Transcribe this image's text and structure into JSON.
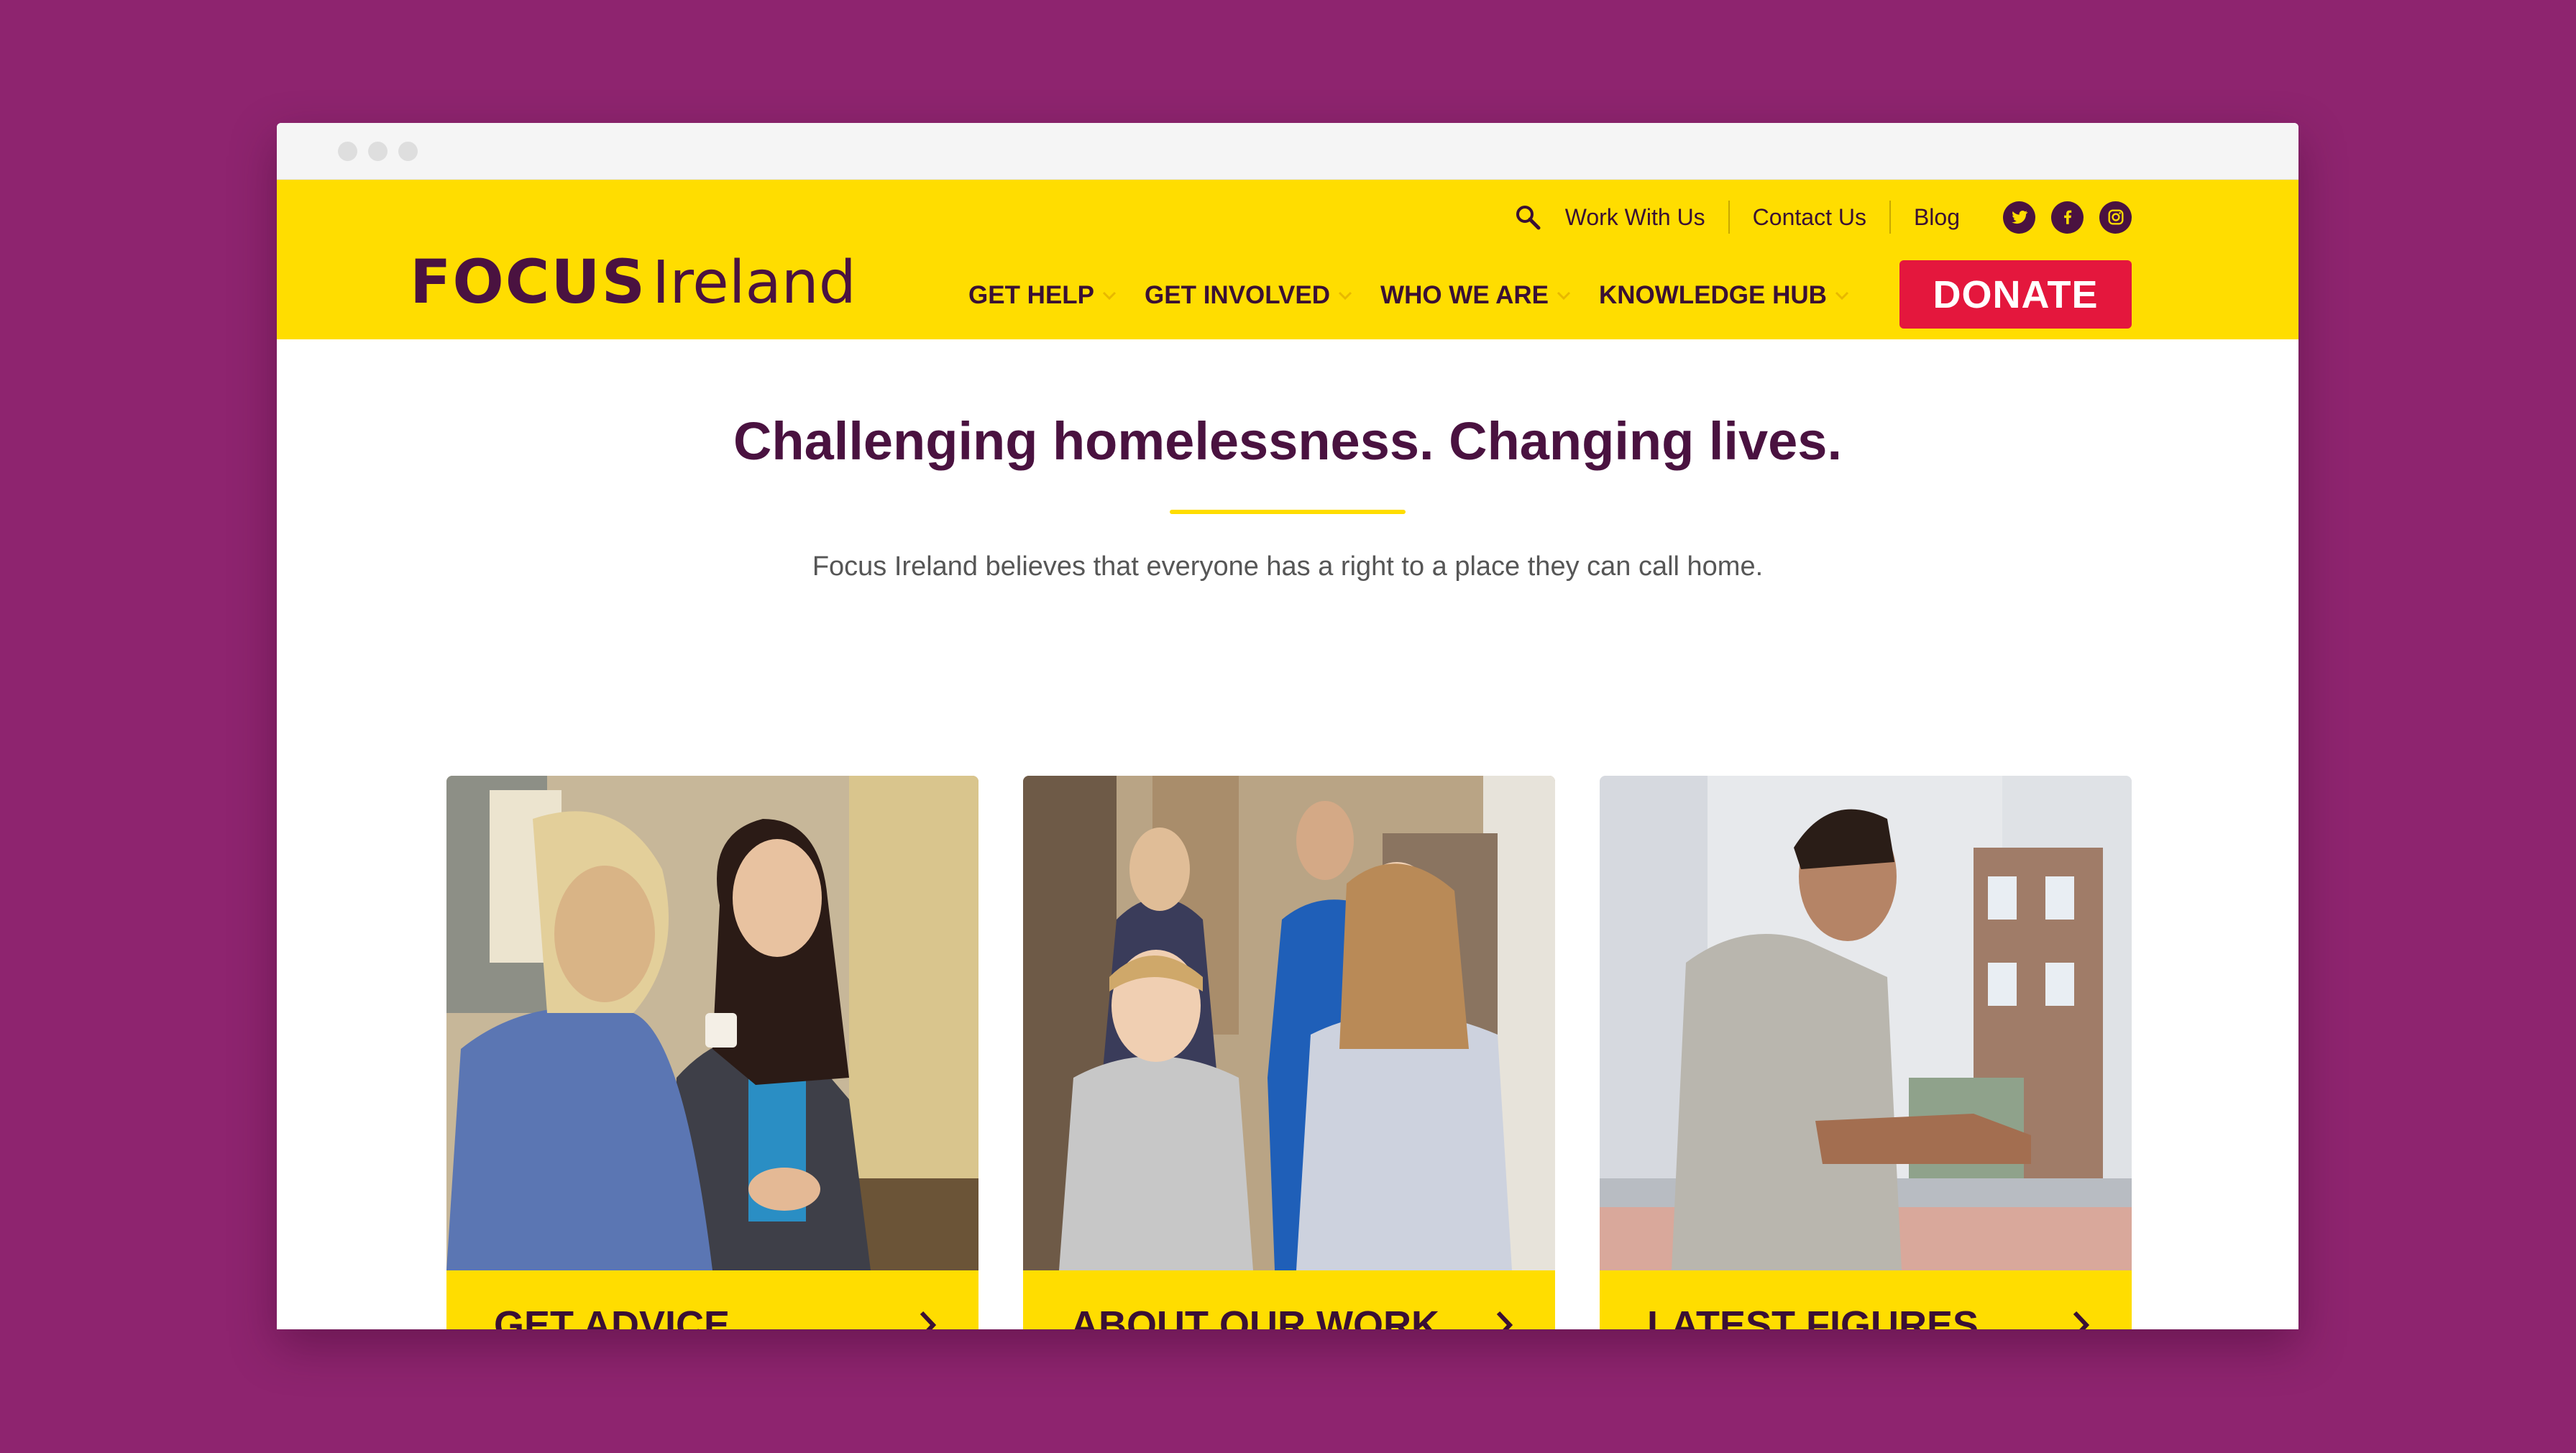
{
  "page": {
    "background_color": "#8e246f"
  },
  "browser": {
    "dots": 3
  },
  "header": {
    "background_color": "#ffdd00",
    "logo": {
      "focus": "FOCUS",
      "ireland": "Ireland"
    },
    "top_links": [
      {
        "label": "Work With Us"
      },
      {
        "label": "Contact Us"
      },
      {
        "label": "Blog"
      }
    ],
    "search_icon": "search-icon",
    "socials": [
      {
        "icon": "twitter-icon"
      },
      {
        "icon": "facebook-icon"
      },
      {
        "icon": "instagram-icon"
      }
    ],
    "nav": [
      {
        "label": "GET HELP"
      },
      {
        "label": "GET INVOLVED"
      },
      {
        "label": "WHO WE ARE"
      },
      {
        "label": "KNOWLEDGE HUB"
      }
    ],
    "donate_label": "DONATE",
    "donate_color": "#e4173d"
  },
  "main": {
    "headline": "Challenging homelessness. Changing lives.",
    "subtitle": "Focus Ireland believes that everyone has a right to a place they can call home.",
    "cards": [
      {
        "label": "GET ADVICE",
        "icon": "chevron-right-icon"
      },
      {
        "label": "ABOUT OUR WORK",
        "icon": "chevron-right-icon"
      },
      {
        "label": "LATEST FIGURES",
        "icon": "chevron-right-icon"
      }
    ]
  },
  "colors": {
    "brand_purple": "#4a1240",
    "accent_yellow": "#ffdd00"
  }
}
